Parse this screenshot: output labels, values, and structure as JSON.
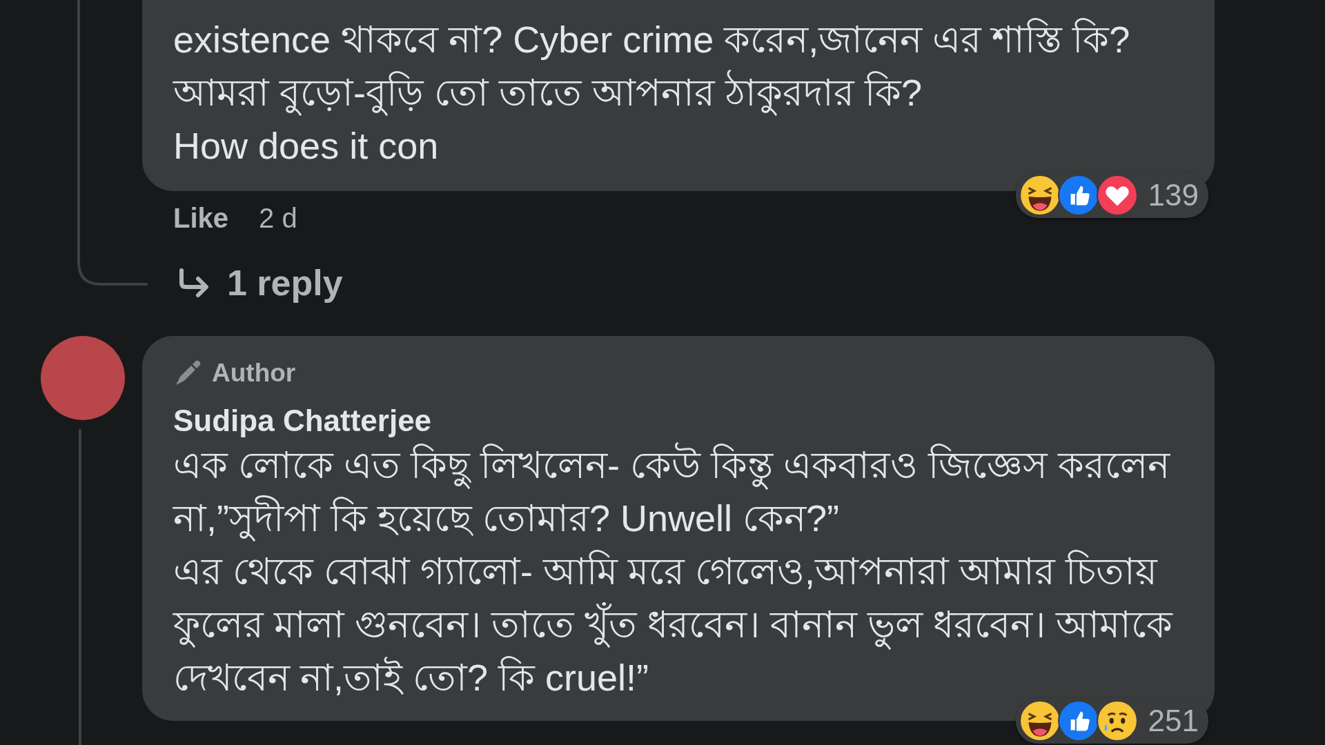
{
  "comments": [
    {
      "text": "existence থাকবে না? Cyber crime করেন,জানেন এর শাস্তি কি? আমরা বুড়ো-বুড়ি তো তাতে আপনার ঠাকুরদার কি?\nHow does it con",
      "reactions": [
        {
          "kind": "haha"
        },
        {
          "kind": "like"
        },
        {
          "kind": "love"
        }
      ],
      "reaction_count": "139",
      "like": "Like",
      "time": "2 d",
      "replies": "1 reply"
    },
    {
      "badge": "Author",
      "name": "Sudipa Chatterjee",
      "text": "এক লোকে এত কিছু লিখলেন- কেউ কিন্তু একবারও জিজ্ঞেস করলেন না,”সুদীপা কি হয়েছে তোমার? Unwell কেন?”\nএর থেকে বোঝা গ্যালো- আমি মরে গেলেও,আপনারা আমার চিতায় ফুলের মালা গুনবেন। তাতে খুঁত ধরবেন। বানান ভুল ধরবেন। আমাকে দেখবেন না,তাই তো? কি cruel!”",
      "reactions": [
        {
          "kind": "haha"
        },
        {
          "kind": "like"
        },
        {
          "kind": "sad"
        }
      ],
      "reaction_count": "251"
    }
  ]
}
